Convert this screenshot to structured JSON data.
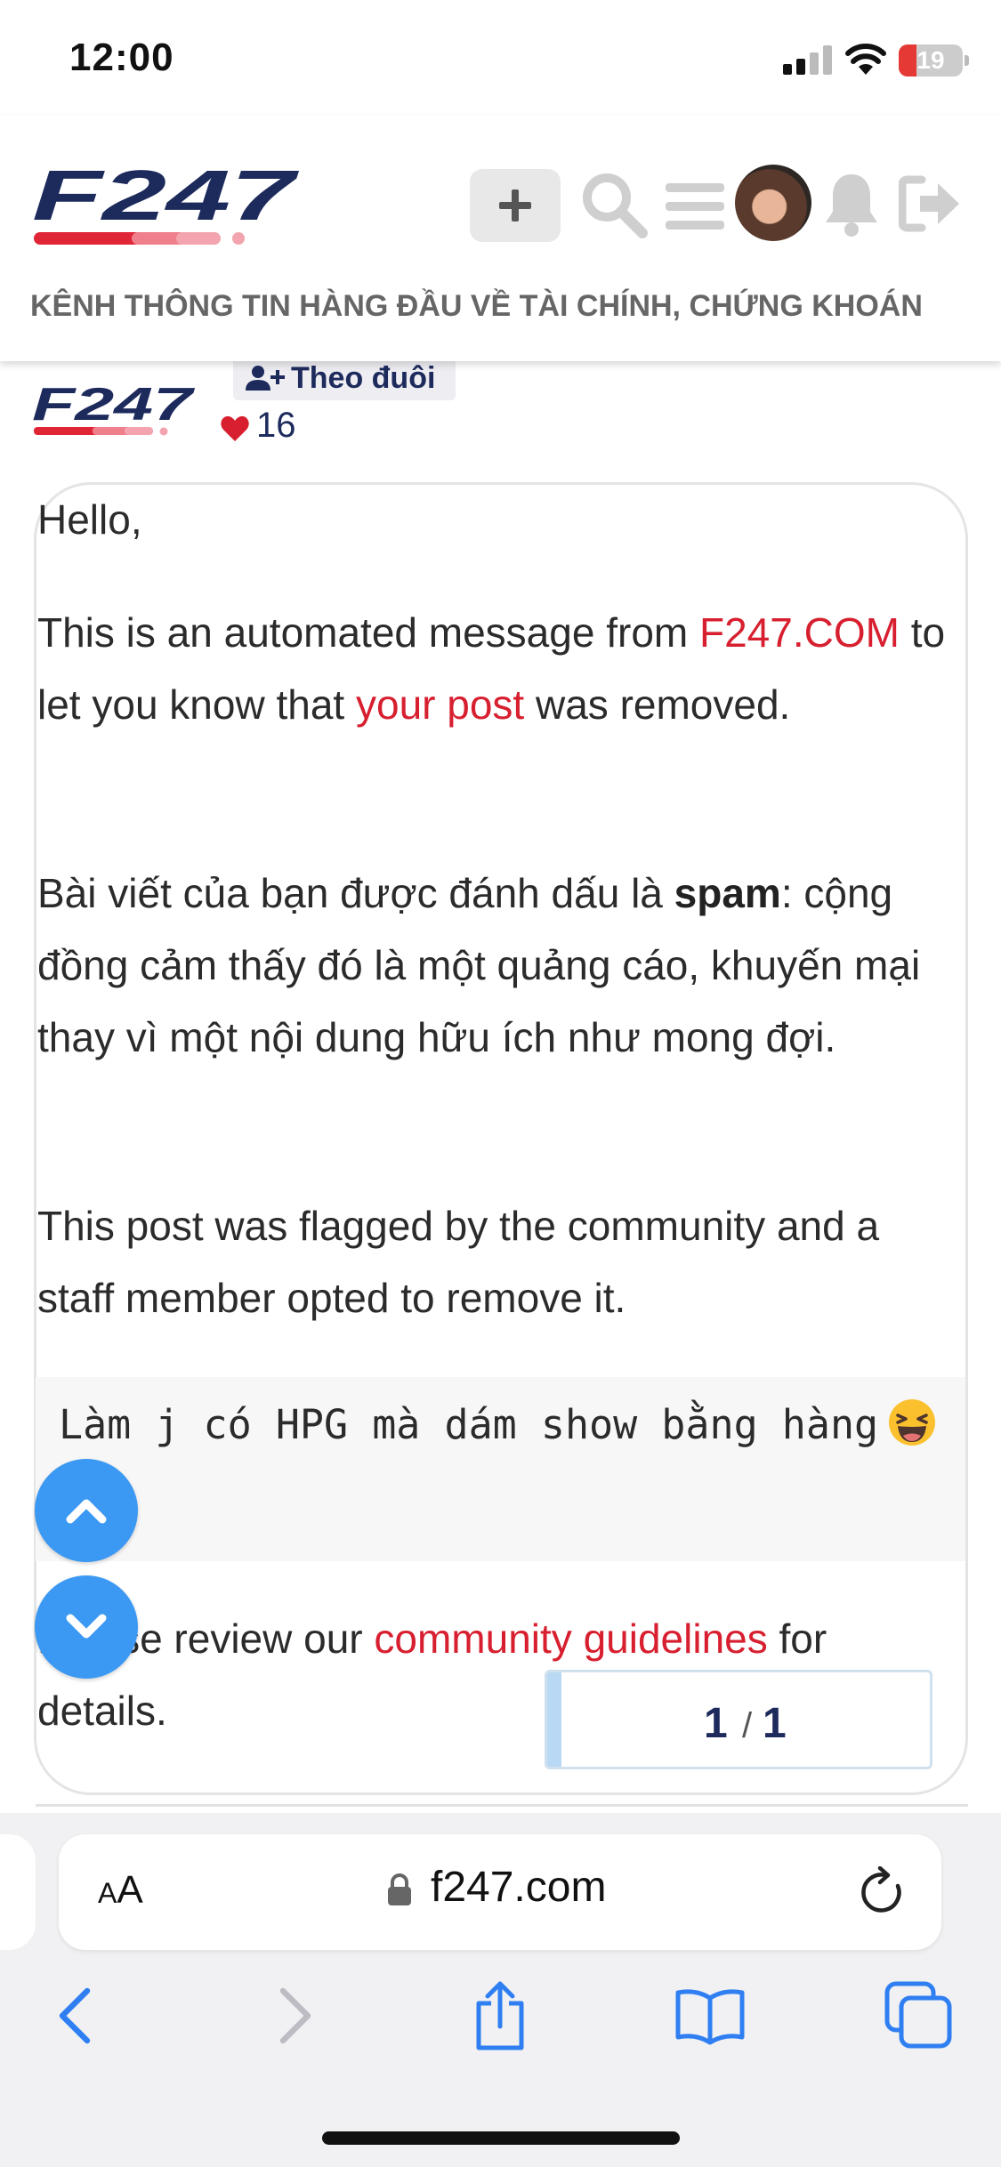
{
  "status_bar": {
    "time": "12:00",
    "battery": "19"
  },
  "header": {
    "logo_text": "F247",
    "tagline": "KÊNH THÔNG TIN HÀNG ĐẦU VỀ TÀI CHÍNH, CHỨNG KHOÁN",
    "icons": [
      "plus-icon",
      "search-icon",
      "menu-icon",
      "avatar",
      "bell-icon",
      "logout-icon"
    ]
  },
  "author": {
    "logo_text": "F247",
    "follow_label": "Theo đuôi",
    "likes": "16"
  },
  "message": {
    "greeting": "Hello,",
    "p1_before": "This is an automated message from ",
    "p1_link1": "F247.COM",
    "p1_mid": " to let you know that ",
    "p1_link2": "your post",
    "p1_after": " was removed.",
    "p2_before": "Bài viết của bạn được đánh dấu là ",
    "p2_bold": "spam",
    "p2_after": ": cộng đồng cảm thấy đó là một quảng cáo, khuyến mại thay vì một nội dung hữu ích như mong đợi.",
    "p3": "This post was flagged by the community and a staff member opted to remove it.",
    "quote": "Làm j có HPG mà dám show bằng hàng",
    "p4_before": "Please review our ",
    "p4_link": "community guidelines",
    "p4_after": " for details."
  },
  "pager": {
    "current": "1",
    "separator": "/",
    "total": "1"
  },
  "browser": {
    "aa_label_small": "A",
    "aa_label_large": "A",
    "url": "f247.com"
  },
  "colors": {
    "brand_navy": "#1d2a5c",
    "brand_red": "#d71f2f",
    "scroll_button_blue": "#3b99f3"
  }
}
